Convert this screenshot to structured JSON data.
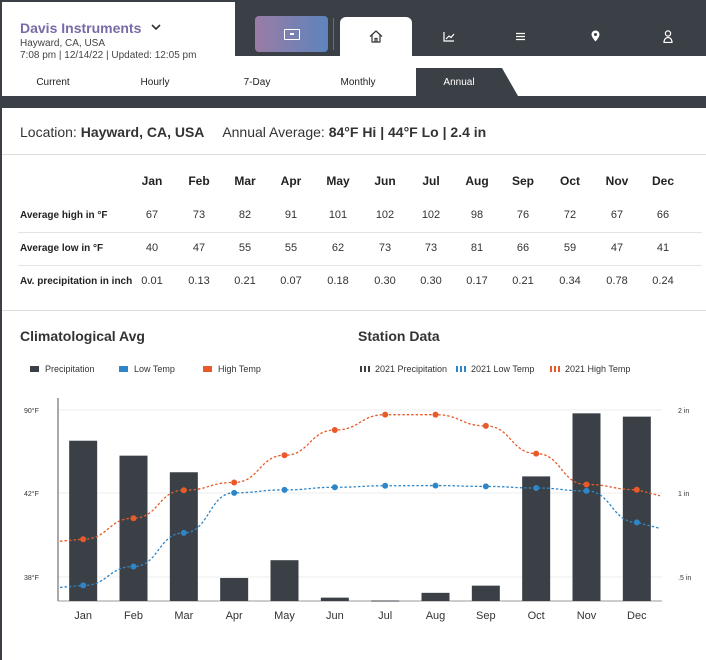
{
  "header": {
    "station_name": "Davis Instruments",
    "location": "Hayward, CA, USA",
    "status_line": "7:08 pm | 12/14/22 | Updated: 12:05 pm"
  },
  "nav": {
    "icons": [
      "weather-widget-icon",
      "home-icon",
      "chart-icon",
      "list-icon",
      "map-pin-icon",
      "user-icon"
    ],
    "active": "home"
  },
  "subtabs": [
    {
      "label": "Current"
    },
    {
      "label": "Hourly"
    },
    {
      "label": "7-Day"
    },
    {
      "label": "Monthly"
    },
    {
      "label": "Annual"
    }
  ],
  "active_subtab": "Annual",
  "summary": {
    "location_label": "Location:",
    "location_value": "Hayward, CA, USA",
    "annual_label": "Annual Average:",
    "annual_value": "84°F Hi | 44°F Lo | 2.4 in"
  },
  "table": {
    "months": [
      "Jan",
      "Feb",
      "Mar",
      "Apr",
      "May",
      "Jun",
      "Jul",
      "Aug",
      "Sep",
      "Oct",
      "Nov",
      "Dec"
    ],
    "rows": [
      {
        "label": "Average high in °F",
        "values": [
          "67",
          "73",
          "82",
          "91",
          "101",
          "102",
          "102",
          "98",
          "76",
          "72",
          "67",
          "66"
        ]
      },
      {
        "label": "Average low in °F",
        "values": [
          "40",
          "47",
          "55",
          "55",
          "62",
          "73",
          "73",
          "81",
          "66",
          "59",
          "47",
          "41"
        ]
      },
      {
        "label": "Av. precipitation in inch",
        "values": [
          "0.01",
          "0.13",
          "0.21",
          "0.07",
          "0.18",
          "0.30",
          "0.30",
          "0.17",
          "0.21",
          "0.34",
          "0.78",
          "0.24"
        ]
      }
    ]
  },
  "charts": {
    "climatological_title": "Climatological Avg",
    "station_title": "Station Data",
    "legend_left": [
      "Precipitation",
      "Low Temp",
      "High Temp"
    ],
    "legend_right": [
      "2021 Precipitation",
      "2021 Low Temp",
      "2021 High Temp"
    ]
  },
  "colors": {
    "precip": "#3b4046",
    "low": "#2e86c8",
    "high": "#e85a2a",
    "nav_bg": "#3b4046",
    "station_name": "#7b6aa8"
  },
  "chart_data": {
    "type": "bar",
    "categories": [
      "Jan",
      "Feb",
      "Mar",
      "Apr",
      "May",
      "Jun",
      "Jul",
      "Aug",
      "Sep",
      "Oct",
      "Nov",
      "Dec"
    ],
    "y_left_ticks": [
      "90°F",
      "42°F",
      "38°F"
    ],
    "y_right_ticks": [
      "2 in",
      "1 in",
      ".5 in"
    ],
    "series": [
      {
        "name": "Precipitation",
        "kind": "bar",
        "axis": "right",
        "values": [
          1.63,
          1.45,
          1.25,
          0.48,
          0.6,
          0.07,
          0.01,
          0.17,
          0.32,
          1.2,
          1.96,
          1.92
        ]
      },
      {
        "name": "Low Temp",
        "kind": "line",
        "axis": "left",
        "values": [
          37.6,
          38.5,
          40.1,
          42.1,
          43.8,
          45.3,
          46.2,
          46.3,
          45.8,
          44.9,
          43.2,
          40.6
        ]
      },
      {
        "name": "High Temp",
        "kind": "line",
        "axis": "left",
        "values": [
          39.8,
          40.8,
          43.6,
          48.1,
          63.8,
          78.4,
          87.3,
          87.3,
          80.8,
          64.8,
          46.9,
          43.9
        ]
      }
    ]
  }
}
